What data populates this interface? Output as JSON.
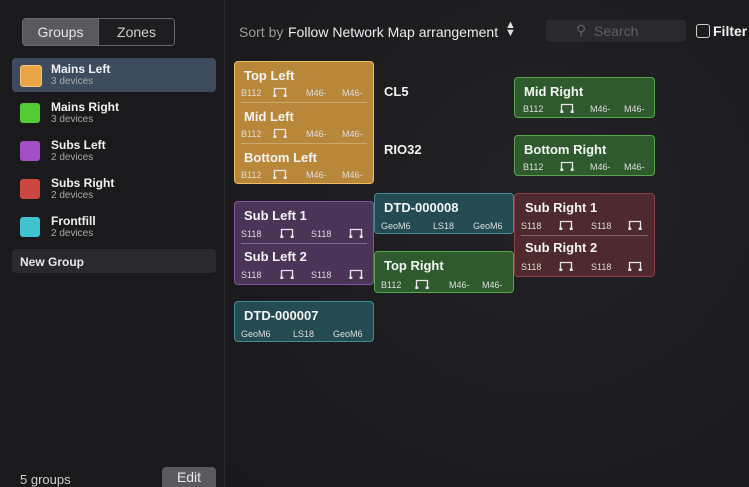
{
  "sidebar": {
    "tabs": [
      "Groups",
      "Zones"
    ],
    "groups": [
      {
        "name": "Mains Left",
        "count": "3 devices",
        "color": "#e8a445"
      },
      {
        "name": "Mains Right",
        "count": "3 devices",
        "color": "#52cc34"
      },
      {
        "name": "Subs Left",
        "count": "2 devices",
        "color": "#a24fc5"
      },
      {
        "name": "Subs Right",
        "count": "2 devices",
        "color": "#cc4740"
      },
      {
        "name": "Frontfill",
        "count": "2 devices",
        "color": "#3fc3cf"
      }
    ],
    "new_group": "New Group",
    "footer_count": "5 groups",
    "edit": "Edit"
  },
  "toolbar": {
    "sort_label": "Sort by",
    "sort_value": "Follow Network Map arrangement",
    "sort_icon": "▲▼",
    "search_icon": "⚲",
    "search_placeholder": "Search",
    "filter": "Filter"
  },
  "map": {
    "mains_left": {
      "rows": [
        {
          "title": "Top Left",
          "specs": [
            "B112",
            "M46-",
            "M46-"
          ]
        },
        {
          "title": "Mid Left",
          "specs": [
            "B112",
            "M46-",
            "M46-"
          ]
        },
        {
          "title": "Bottom Left",
          "specs": [
            "B112",
            "M46-",
            "M46-"
          ]
        }
      ]
    },
    "cl5": "CL5",
    "rio32": "RIO32",
    "mid_right": {
      "title": "Mid Right",
      "specs": [
        "B112",
        "M46-",
        "M46-"
      ]
    },
    "bottom_right": {
      "title": "Bottom Right",
      "specs": [
        "B112",
        "M46-",
        "M46-"
      ]
    },
    "subs_left": {
      "rows": [
        {
          "title": "Sub Left 1",
          "specs": [
            "S118",
            "S118"
          ]
        },
        {
          "title": "Sub Left 2",
          "specs": [
            "S118",
            "S118"
          ]
        }
      ]
    },
    "dtd8": {
      "title": "DTD-000008",
      "specs": [
        "GeoM6",
        "LS18",
        "GeoM6"
      ]
    },
    "top_right": {
      "title": "Top Right",
      "specs": [
        "B112",
        "M46-",
        "M46-"
      ]
    },
    "subs_right": {
      "rows": [
        {
          "title": "Sub Right 1",
          "specs": [
            "S118",
            "S118"
          ]
        },
        {
          "title": "Sub Right 2",
          "specs": [
            "S118",
            "S118"
          ]
        }
      ]
    },
    "dtd7": {
      "title": "DTD-000007",
      "specs": [
        "GeoM6",
        "LS18",
        "GeoM6"
      ]
    },
    "amp_icon": "speaker-cable-icon"
  }
}
